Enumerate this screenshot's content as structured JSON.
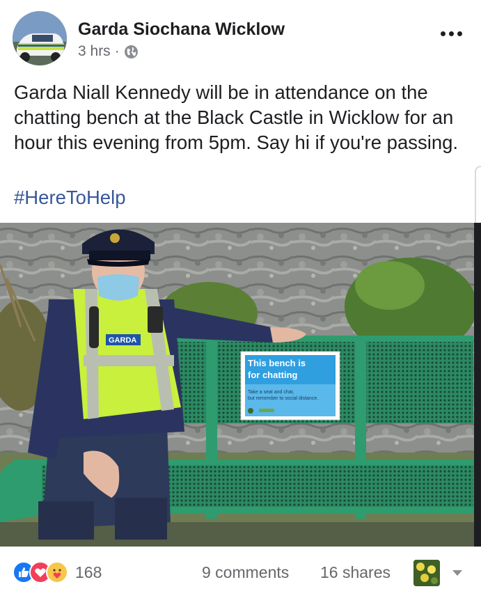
{
  "post": {
    "page_name": "Garda Siochana Wicklow",
    "time": "3 hrs",
    "separator": "·",
    "privacy_icon": "globe-icon",
    "more_icon": "more-options-icon",
    "text": "Garda Niall Kennedy will be in attendance on the chatting bench at the Black Castle in Wicklow for an hour this evening from 5pm. Say hi if you're passing.",
    "hashtag": "#HereToHelp"
  },
  "photo": {
    "badge_text": "GARDA",
    "sign_title_line1": "This bench is",
    "sign_title_line2": "for chatting",
    "sign_small_line1": "Take a seat and chat,",
    "sign_small_line2": "but remember to social distance."
  },
  "footer": {
    "reaction_icons": [
      "like-icon",
      "love-icon",
      "care-icon"
    ],
    "reaction_count": "168",
    "comments": "9 comments",
    "shares": "16 shares",
    "caret_icon": "chevron-down-icon"
  },
  "colors": {
    "link": "#385898",
    "secondary_text": "#65676b",
    "like_blue": "#1877f2",
    "love_red": "#f33e58",
    "bench_green": "#2e9c6e",
    "hi_vis_yellow": "#c8f03c"
  }
}
